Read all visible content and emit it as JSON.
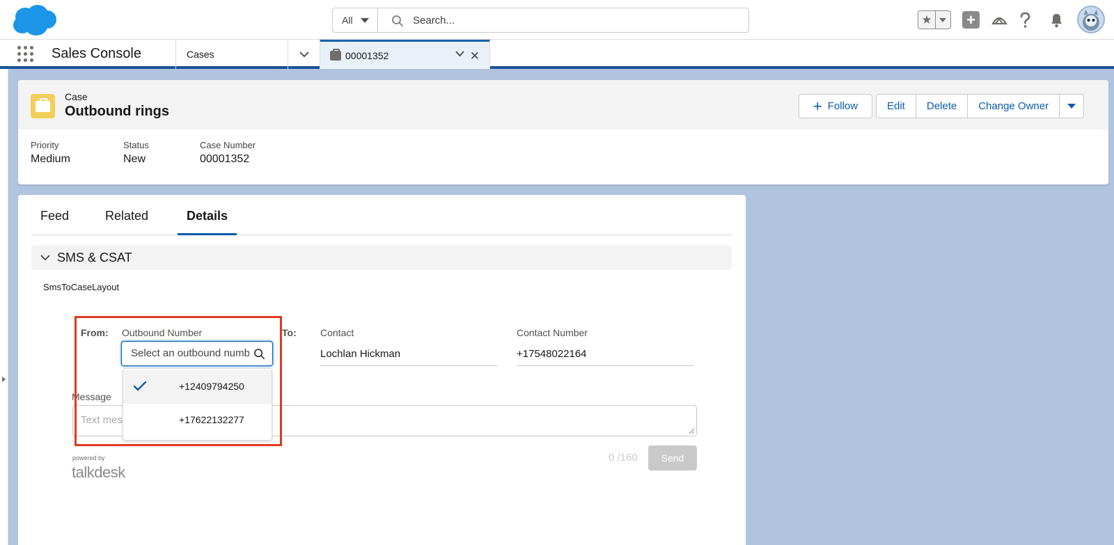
{
  "header": {
    "search_scope": "All",
    "search_placeholder": "Search..."
  },
  "icons": {
    "logo": "salesforce-cloud-logo",
    "favorites": "star-icon",
    "global_actions": "plus-icon",
    "setup": "trailhead-icon",
    "help": "question-icon",
    "notifications": "bell-icon",
    "avatar": "user-avatar"
  },
  "nav": {
    "app_name": "Sales Console",
    "object_tab": "Cases",
    "record_tab": "00001352"
  },
  "record": {
    "object_label": "Case",
    "title": "Outbound rings",
    "actions": {
      "follow": "Follow",
      "edit": "Edit",
      "delete": "Delete",
      "change_owner": "Change Owner"
    },
    "highlights": [
      {
        "label": "Priority",
        "value": "Medium"
      },
      {
        "label": "Status",
        "value": "New"
      },
      {
        "label": "Case Number",
        "value": "00001352"
      }
    ]
  },
  "tabs": [
    {
      "label": "Feed",
      "active": false
    },
    {
      "label": "Related",
      "active": false
    },
    {
      "label": "Details",
      "active": true
    }
  ],
  "section": {
    "title": "SMS & CSAT",
    "layout_name": "SmsToCaseLayout"
  },
  "sms": {
    "from_label": "From:",
    "outbound_label": "Outbound Number",
    "outbound_placeholder": "Select an outbound number",
    "to_label": "To:",
    "contact_label": "Contact",
    "contact_value": "Lochlan Hickman",
    "contact_number_label": "Contact Number",
    "contact_number_value": "+17548022164",
    "message_label": "Message",
    "message_placeholder": "Text message",
    "counter": "0 /160",
    "send_label": "Send",
    "powered_by": "powered by",
    "brand": "talkdesk",
    "options": [
      {
        "number": "+12409794250",
        "selected": true
      },
      {
        "number": "+17622132277",
        "selected": false
      }
    ]
  },
  "colors": {
    "brand_blue": "#0b5cab",
    "nav_accent": "#1b5297",
    "case_icon": "#f2cf5b",
    "highlight_box": "#e03a1f",
    "workspace_bg": "#b0c4df"
  }
}
